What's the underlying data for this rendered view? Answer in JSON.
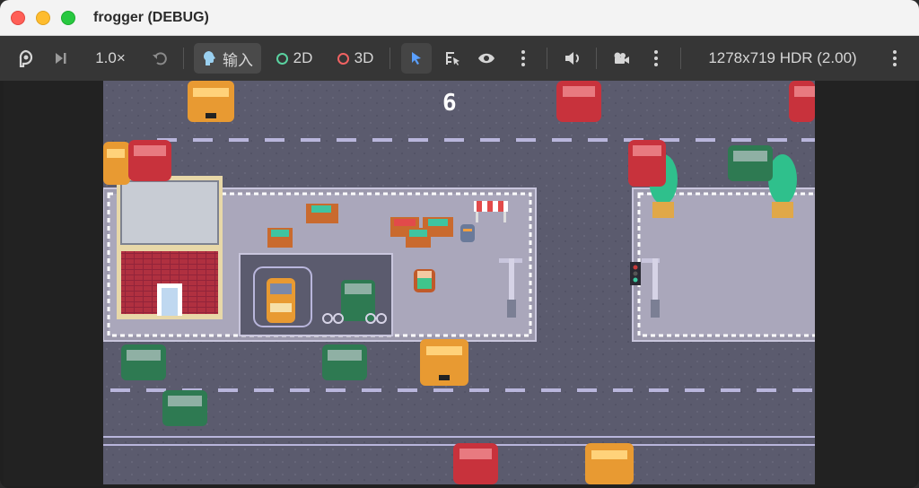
{
  "window": {
    "title": "frogger (DEBUG)"
  },
  "toolbar": {
    "speed": "1.0×",
    "input_label": "输入",
    "mode_2d": "2D",
    "mode_3d": "3D",
    "resolution": "1278x719 HDR (2.00)",
    "colors": {
      "ring_2d": "#5ad2a0",
      "ring_3d": "#f06262",
      "select_accent": "#5aa0ff"
    }
  },
  "game": {
    "score": "6",
    "colors": {
      "road": "#5b5b6e",
      "sidewalk": "#a7a4b8",
      "lane_mark": "#b9b6dc",
      "car_red": "#c8323c",
      "car_green": "#2e7a52",
      "taxi_orange": "#e89a32",
      "building_brick": "#b03040",
      "tree": "#2fc08c"
    }
  }
}
